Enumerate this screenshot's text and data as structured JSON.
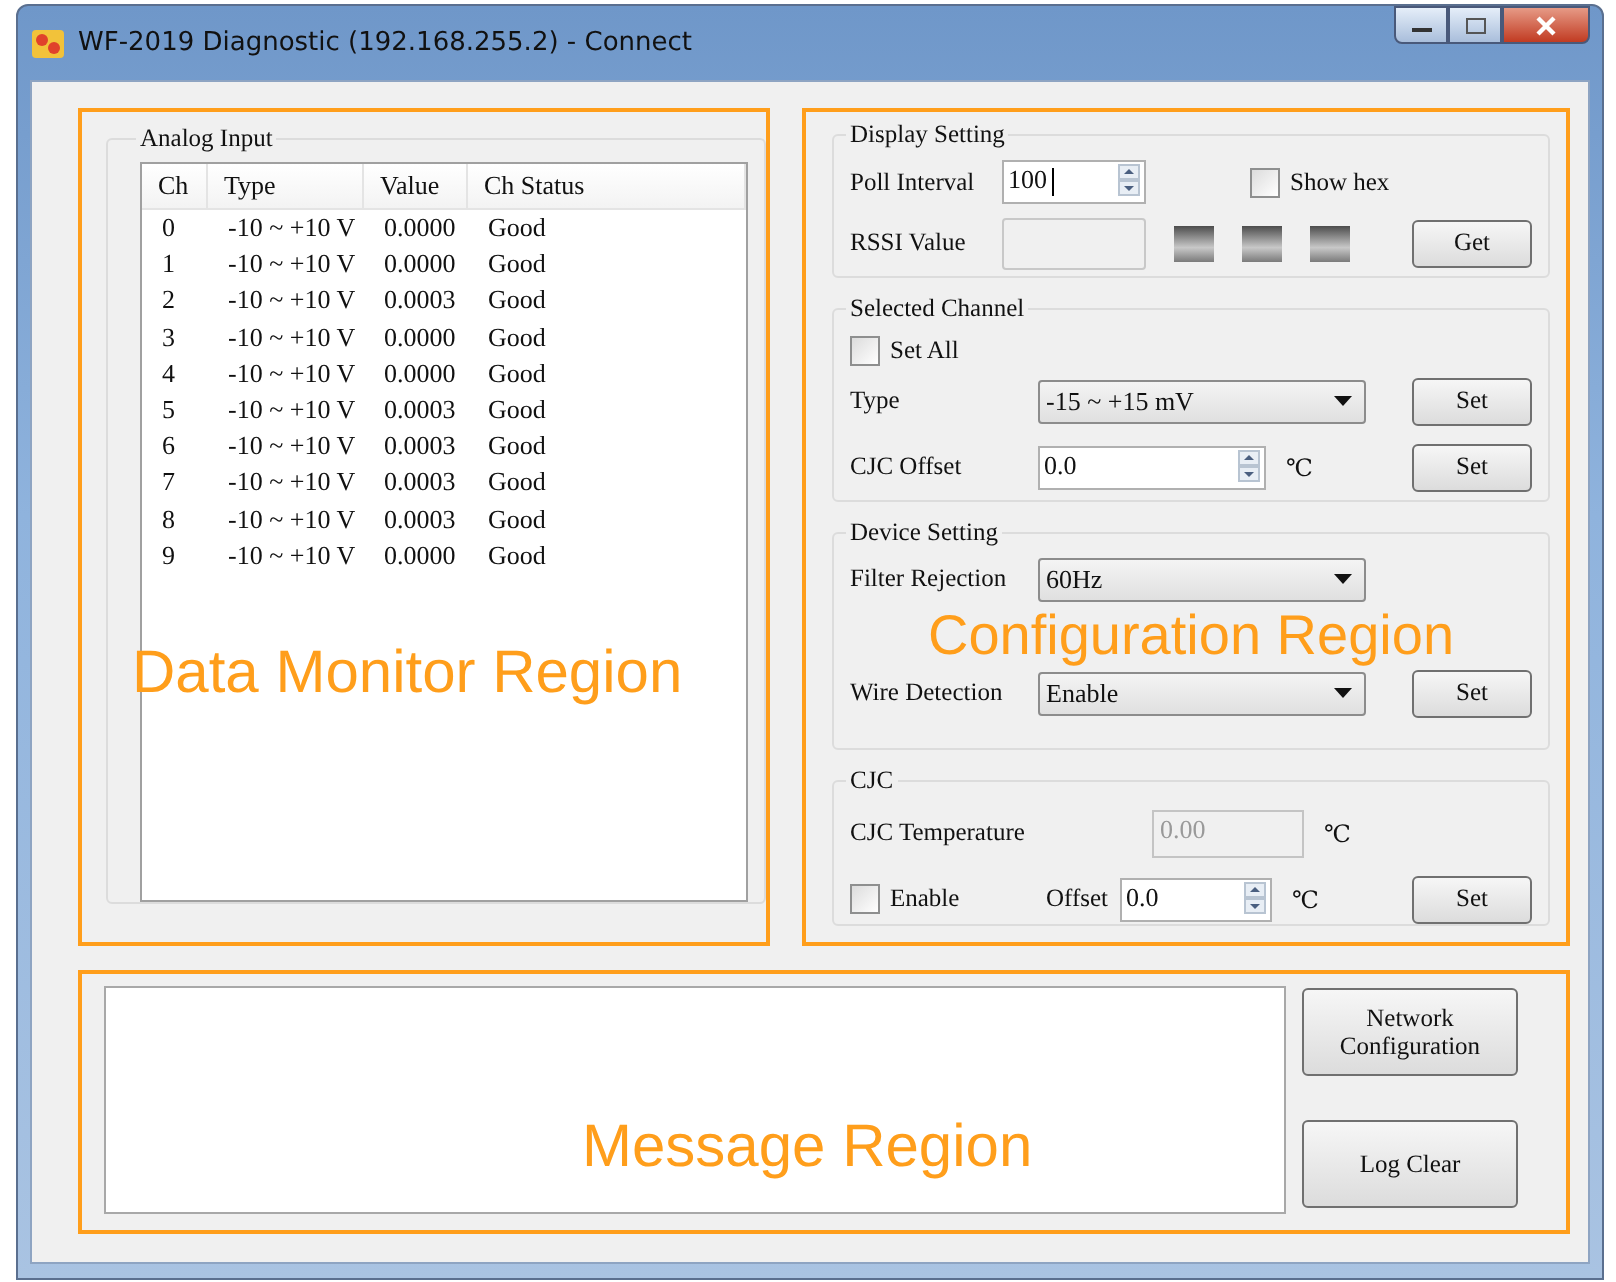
{
  "window": {
    "title": "WF-2019 Diagnostic (192.168.255.2) - Connect"
  },
  "data_monitor": {
    "annotation": "Data Monitor Region",
    "analog_input": {
      "title": "Analog Input",
      "columns": [
        "Ch",
        "Type",
        "Value",
        "Ch Status"
      ],
      "rows": [
        [
          "0",
          "-10 ~ +10 V",
          "0.0000",
          "Good"
        ],
        [
          "1",
          "-10 ~ +10 V",
          "0.0000",
          "Good"
        ],
        [
          "2",
          "-10 ~ +10 V",
          "0.0003",
          "Good"
        ],
        [
          "3",
          "-10 ~ +10 V",
          "0.0000",
          "Good"
        ],
        [
          "4",
          "-10 ~ +10 V",
          "0.0000",
          "Good"
        ],
        [
          "5",
          "-10 ~ +10 V",
          "0.0003",
          "Good"
        ],
        [
          "6",
          "-10 ~ +10 V",
          "0.0003",
          "Good"
        ],
        [
          "7",
          "-10 ~ +10 V",
          "0.0003",
          "Good"
        ],
        [
          "8",
          "-10 ~ +10 V",
          "0.0003",
          "Good"
        ],
        [
          "9",
          "-10 ~ +10 V",
          "0.0000",
          "Good"
        ]
      ]
    }
  },
  "configuration": {
    "annotation": "Configuration Region",
    "display_setting": {
      "title": "Display Setting",
      "poll_interval_label": "Poll Interval",
      "poll_interval_value": "100",
      "show_hex": {
        "label": "Show hex",
        "checked": false
      },
      "rssi_label": "RSSI Value",
      "get_button": "Get"
    },
    "selected_channel": {
      "title": "Selected Channel",
      "set_all": {
        "label": "Set All",
        "checked": false
      },
      "type_label": "Type",
      "type_value": "-15 ~ +15 mV",
      "type_button": "Set",
      "cjc_offset_label": "CJC Offset",
      "cjc_offset_value": "0.0",
      "cjc_offset_unit": "℃",
      "cjc_offset_button": "Set"
    },
    "device_setting": {
      "title": "Device Setting",
      "filter_label": "Filter Rejection",
      "filter_value": "60Hz",
      "wire_label": "Wire Detection",
      "wire_value": "Enable",
      "wire_button": "Set"
    },
    "cjc": {
      "title": "CJC",
      "temperature_label": "CJC Temperature",
      "temperature_value": "0.00",
      "temperature_unit": "℃",
      "enable": {
        "label": "Enable",
        "checked": false
      },
      "offset_label": "Offset",
      "offset_value": "0.0",
      "offset_unit": "℃",
      "offset_button": "Set"
    }
  },
  "message": {
    "annotation": "Message Region",
    "buttons": [
      "Network Configuration",
      "Log Clear"
    ]
  }
}
